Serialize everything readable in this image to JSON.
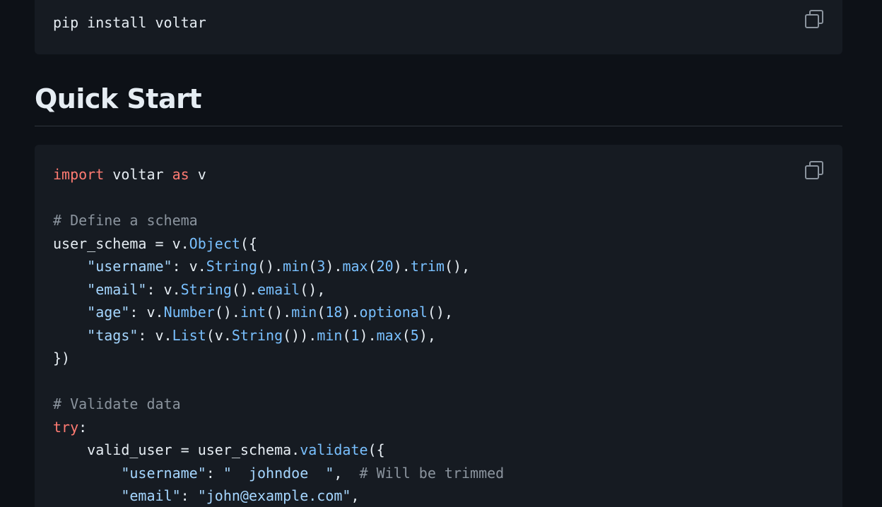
{
  "install": {
    "command": "pip install voltar",
    "copy_icon": "copy-icon"
  },
  "quick_start": {
    "heading": "Quick Start",
    "copy_icon": "copy-icon",
    "code": {
      "l1_import": "import",
      "l1_module": " voltar ",
      "l1_as": "as",
      "l1_alias": " v",
      "c1": "# Define a schema",
      "l3_a": "user_schema = v.",
      "l3_fn": "Object",
      "l3_b": "({",
      "l4_key": "\"username\"",
      "l4_a": ": v.",
      "l4_f1": "String",
      "l4_b": "().",
      "l4_f2": "min",
      "l4_c": "(",
      "l4_n1": "3",
      "l4_d": ").",
      "l4_f3": "max",
      "l4_e": "(",
      "l4_n2": "20",
      "l4_g": ").",
      "l4_f4": "trim",
      "l4_h": "(),",
      "l5_key": "\"email\"",
      "l5_a": ": v.",
      "l5_f1": "String",
      "l5_b": "().",
      "l5_f2": "email",
      "l5_c": "(),",
      "l6_key": "\"age\"",
      "l6_a": ": v.",
      "l6_f1": "Number",
      "l6_b": "().",
      "l6_f2": "int",
      "l6_c": "().",
      "l6_f3": "min",
      "l6_d": "(",
      "l6_n1": "18",
      "l6_e": ").",
      "l6_f4": "optional",
      "l6_g": "(),",
      "l7_key": "\"tags\"",
      "l7_a": ": v.",
      "l7_f1": "List",
      "l7_b": "(v.",
      "l7_f2": "String",
      "l7_c": "()).",
      "l7_f3": "min",
      "l7_d": "(",
      "l7_n1": "1",
      "l7_e": ").",
      "l7_f4": "max",
      "l7_g": "(",
      "l7_n2": "5",
      "l7_h": "),",
      "l8": "})",
      "c2": "# Validate data",
      "l10_kw": "try",
      "l10_a": ":",
      "l11_a": "valid_user = user_schema.",
      "l11_fn": "validate",
      "l11_b": "({",
      "l12_key": "\"username\"",
      "l12_a": ": ",
      "l12_val": "\"  johndoe  \"",
      "l12_b": ",  ",
      "l12_cm": "# Will be trimmed",
      "l13_key": "\"email\"",
      "l13_a": ": ",
      "l13_val": "\"john@example.com\"",
      "l13_b": ","
    }
  },
  "colors": {
    "background": "#0d1117",
    "code_background": "#161b22",
    "keyword": "#ff7b72",
    "function": "#79c0ff",
    "string": "#a5d6ff",
    "comment": "#8b949e",
    "text": "#e6edf3"
  }
}
